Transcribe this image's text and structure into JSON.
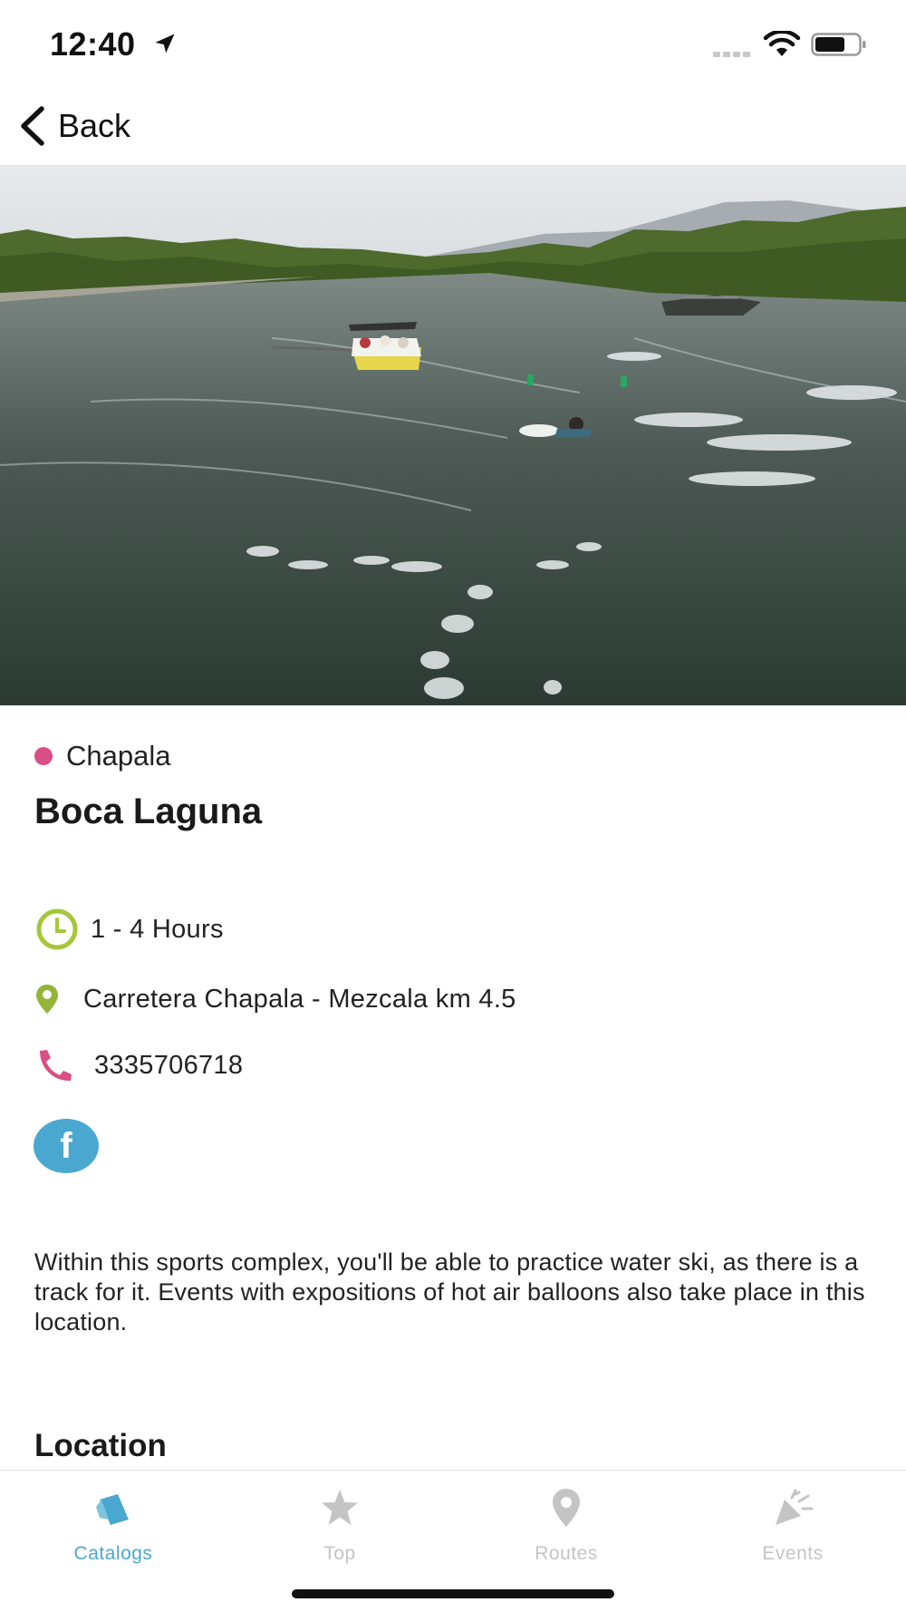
{
  "status_bar": {
    "time": "12:40",
    "icons": [
      "location-arrow-icon",
      "signal-icon",
      "wifi-icon",
      "battery-icon"
    ]
  },
  "nav": {
    "back_label": "Back",
    "back_icon": "chevron-left-icon"
  },
  "gallery": {
    "image_count": 4,
    "active_index": 0,
    "description": "photo of a lake with a boat towing a water skier"
  },
  "place": {
    "region": "Chapala",
    "region_color": "#d94f86",
    "name": "Boca Laguna",
    "duration": "1 - 4 Hours",
    "address": "Carretera Chapala - Mezcala km 4.5",
    "phone": "3335706718",
    "social": [
      "facebook-icon"
    ],
    "description": "Within this sports complex, you'll be able to practice water ski, as there is a track for it. Events with expositions of hot air balloons also take place in this location."
  },
  "sections": {
    "location_title": "Location"
  },
  "tabs": [
    {
      "label": "Catalogs",
      "icon": "catalogs-icon",
      "active": true
    },
    {
      "label": "Top",
      "icon": "star-icon",
      "active": false
    },
    {
      "label": "Routes",
      "icon": "map-pin-icon",
      "active": false
    },
    {
      "label": "Events",
      "icon": "party-popper-icon",
      "active": false
    }
  ],
  "colors": {
    "accent": "#4aa8d0",
    "icon_green": "#a6c63a",
    "pink": "#d94f86",
    "inactive": "#c4c4c4"
  }
}
